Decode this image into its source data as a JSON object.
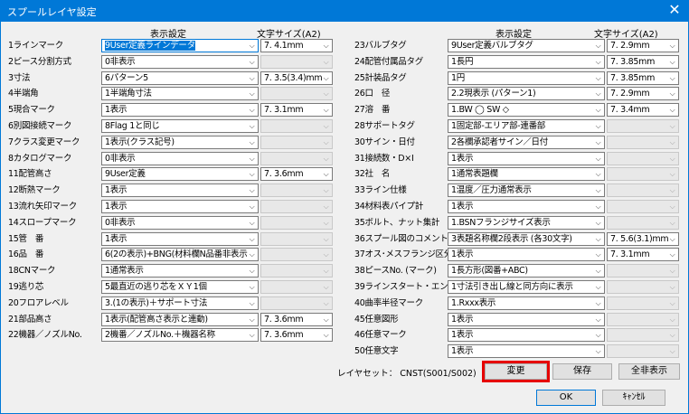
{
  "window": {
    "title": "スプールレイヤ設定",
    "close_glyph": "✕"
  },
  "headers": {
    "left_display": "表示設定",
    "left_size": "文字サイズ(A2)",
    "right_display": "表示設定",
    "right_size": "文字サイズ(A2)"
  },
  "left_rows": [
    {
      "label": "1ラインマーク",
      "value": "9User定義ラインデータ",
      "size": "7.  4.1mm",
      "size_enabled": true,
      "focused": true
    },
    {
      "label": "2ピース分割方式",
      "value": "0非表示",
      "size": "",
      "size_enabled": false
    },
    {
      "label": "3寸法",
      "value": "6パターン5",
      "size": "7.  3.5(3.4)mm",
      "size_enabled": true
    },
    {
      "label": "4半端角",
      "value": "1半端角寸法",
      "size": "",
      "size_enabled": false
    },
    {
      "label": "5現合マーク",
      "value": "1表示",
      "size": "7.  3.1mm",
      "size_enabled": true
    },
    {
      "label": "6別図接続マーク",
      "value": "8Flag 1と同じ",
      "size": "",
      "size_enabled": false
    },
    {
      "label": "7クラス変更マーク",
      "value": "1表示(クラス記号)",
      "size": "",
      "size_enabled": false
    },
    {
      "label": "8カタログマーク",
      "value": "0非表示",
      "size": "",
      "size_enabled": false
    },
    {
      "label": "11配管高さ",
      "value": "9User定義",
      "size": "7.  3.6mm",
      "size_enabled": true
    },
    {
      "label": "12断熱マーク",
      "value": "1表示",
      "size": "",
      "size_enabled": false
    },
    {
      "label": "13流れ矢印マーク",
      "value": "1表示",
      "size": "",
      "size_enabled": false
    },
    {
      "label": "14スロープマーク",
      "value": "0非表示",
      "size": "",
      "size_enabled": false
    },
    {
      "label": "15管　番",
      "value": "1表示",
      "size": "",
      "size_enabled": false
    },
    {
      "label": "16品　番",
      "value": "6(2の表示)+BNG(材料欄N品番非表示",
      "size": "",
      "size_enabled": false
    },
    {
      "label": "18CNマーク",
      "value": "1通常表示",
      "size": "",
      "size_enabled": false
    },
    {
      "label": "19逃り芯",
      "value": "5最直近の逃り芯をＸＹ1個",
      "size": "",
      "size_enabled": false
    },
    {
      "label": "20フロアレベル",
      "value": "3.(1の表示)＋サポート寸法",
      "size": "",
      "size_enabled": false
    },
    {
      "label": "21部品高さ",
      "value": "1表示(配管高さ表示と連動)",
      "size": "7.  3.6mm",
      "size_enabled": true
    },
    {
      "label": "22機器／ノズルNo.",
      "value": "2機番／ノズルNo.＋機器名称",
      "size": "7.  3.6mm",
      "size_enabled": true
    }
  ],
  "right_rows": [
    {
      "label": "23バルブタグ",
      "value": "9User定義バルブタグ",
      "size": "7.  2.9mm",
      "size_enabled": true
    },
    {
      "label": "24配管付属品タグ",
      "value": "1長円",
      "size": "7.  3.85mm",
      "size_enabled": true
    },
    {
      "label": "25計装品タグ",
      "value": "1円",
      "size": "7.  3.85mm",
      "size_enabled": true
    },
    {
      "label": "26口　径",
      "value": "2.2現表示 (パターン1)",
      "size": "7.  2.9mm",
      "size_enabled": true
    },
    {
      "label": "27溶　番",
      "value": "1.BW ◯  SW ◇",
      "size": "7.  3.4mm",
      "size_enabled": true
    },
    {
      "label": "28サポートタグ",
      "value": "1固定部-エリア部-連番部",
      "size": "",
      "size_enabled": false
    },
    {
      "label": "30サイン・日付",
      "value": "2各欄承認者サイン／日付",
      "size": "",
      "size_enabled": false
    },
    {
      "label": "31接続数・D×I",
      "value": "1表示",
      "size": "",
      "size_enabled": false
    },
    {
      "label": "32社　名",
      "value": "1通常表題欄",
      "size": "",
      "size_enabled": false
    },
    {
      "label": "33ライン仕様",
      "value": "1温度／圧力通常表示",
      "size": "",
      "size_enabled": false
    },
    {
      "label": "34材料表パイプ計",
      "value": "1表示",
      "size": "",
      "size_enabled": false
    },
    {
      "label": "35ボルト、ナット集計",
      "value": "1.BSNフランジサイズ表示",
      "size": "",
      "size_enabled": false
    },
    {
      "label": "36スプール図のコメント",
      "value": "3表題名称欄2段表示 (各30文字)",
      "size": "7.  5.6(3.1)mm",
      "size_enabled": true
    },
    {
      "label": "37オス･メスフランジ区分",
      "value": "1表示",
      "size": "7.  3.1mm",
      "size_enabled": true
    },
    {
      "label": "38ピースNo. (マーク)",
      "value": "1長方形(図番+ABC)",
      "size": "",
      "size_enabled": false
    },
    {
      "label": "39ラインスタート・エンド",
      "value": "1寸法引き出し線と同方向に表示",
      "size": "",
      "size_enabled": false
    },
    {
      "label": "40曲率半径マーク",
      "value": "1.Rxxx表示",
      "size": "",
      "size_enabled": false
    },
    {
      "label": "45任意図形",
      "value": "1表示",
      "size": "",
      "size_enabled": false
    },
    {
      "label": "46任意マーク",
      "value": "1表示",
      "size": "",
      "size_enabled": false
    },
    {
      "label": "50任意文字",
      "value": "1表示",
      "size": "",
      "size_enabled": false
    }
  ],
  "footer": {
    "layerset": "レイヤセット： CNST(S001/S002)",
    "change": "変更",
    "save": "保存",
    "show_all": "全非表示",
    "ok": "OK",
    "cancel": "ｷｬﾝｾﾙ"
  },
  "dropdown_arrow": "⌵",
  "colors": {
    "titlebar": "#0078d7",
    "highlight": "#e60000"
  }
}
